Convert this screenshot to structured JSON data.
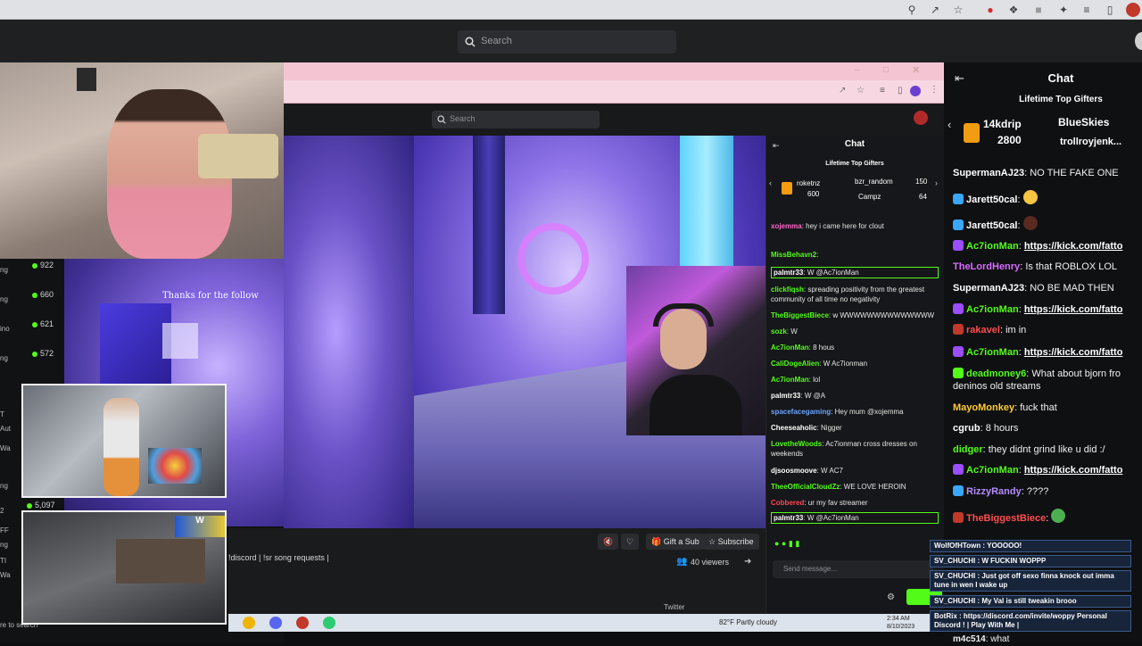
{
  "kick": {
    "search_placeholder": "Search"
  },
  "left_viewers": [
    "922",
    "660",
    "621",
    "572",
    "5,097"
  ],
  "left_side_labels": [
    "ng",
    "ng",
    "ino",
    "ng",
    "T",
    "Aut",
    "Wa",
    "ng",
    "2",
    "FF",
    "ng",
    "TI",
    "Wa",
    "re to search"
  ],
  "overlay_text": "Thanks for the follow",
  "inner": {
    "search_placeholder": "Search",
    "chat_title": "Chat",
    "gifters_title": "Lifetime Top Gifters",
    "top_gifters": [
      {
        "name": "roketnz",
        "amount": "600"
      },
      {
        "name": "bzr_random",
        "amount": "150"
      },
      {
        "name": "Campz",
        "amount": "64"
      }
    ],
    "messages": [
      {
        "user": "xojemma",
        "text": "hey i came here for clout",
        "color": "#ff66cc"
      },
      {
        "user": "MissBehavn2",
        "text": "",
        "color": "#53fc18"
      },
      {
        "user": "palmtr33",
        "text": "W @Ac7ionMan",
        "color": "#ffffff"
      },
      {
        "user": "clickfiqsh",
        "text": "spreading positivity from the greatest community of all time no negativity",
        "color": "#53fc18"
      },
      {
        "user": "TheBiggestBiece",
        "text": "w WWWWWWWWWWWWWW",
        "color": "#53fc18"
      },
      {
        "user": "sozk",
        "text": "W",
        "color": "#53fc18"
      },
      {
        "user": "Ac7ionMan",
        "text": "8 hous",
        "color": "#53fc18"
      },
      {
        "user": "CaliDogeAlien",
        "text": "W Ac7ionman",
        "color": "#53fc18"
      },
      {
        "user": "Ac7ionMan",
        "text": "lol",
        "color": "#53fc18"
      },
      {
        "user": "palmtr33",
        "text": "W @A",
        "color": "#ffffff"
      },
      {
        "user": "spacefacegaming",
        "text": "Hey mum @xojemma",
        "color": "#6aa4ff"
      },
      {
        "user": "Cheeseaholic",
        "text": "Nigger",
        "color": "#ffffff"
      },
      {
        "user": "LovetheWoods",
        "text": "Ac7ionman cross dresses on weekends",
        "color": "#53fc18"
      },
      {
        "user": "djsoosmoove",
        "text": "W AC7",
        "color": "#ffffff"
      },
      {
        "user": "TheeOfficialCloudZz",
        "text": "WE LOVE HEROIN",
        "color": "#53fc18"
      },
      {
        "user": "Cobbered",
        "text": "ur my fav streamer",
        "color": "#ff4455"
      },
      {
        "user": "palmtr33",
        "text": "W @Ac7ionMan",
        "color": "#ffffff"
      }
    ],
    "gift_sub": "Gift a Sub",
    "subscribe": "Subscribe",
    "viewers": "40 viewers",
    "about": "!discord | !sr song requests |",
    "send_placeholder": "Send message...",
    "twitter": "Twitter"
  },
  "taskbar": {
    "weather": "82°F  Partly cloudy",
    "time": "2:34 AM",
    "date": "8/10/2023"
  },
  "outer_chat": {
    "title": "Chat",
    "gifters_title": "Lifetime Top Gifters",
    "top_gifters": [
      {
        "name": "14kdrip",
        "amount": "2800"
      },
      {
        "name": "BlueSkies",
        "amount": ""
      },
      {
        "name": "trollroyjenk...",
        "amount": ""
      }
    ],
    "messages": [
      {
        "user": "SupermanAJ23",
        "text": "NO THE FAKE ONE",
        "color": "#ffffff",
        "badge": ""
      },
      {
        "user": "Jarett50cal",
        "text": "",
        "color": "#ffffff",
        "badge": "#3aa7ff"
      },
      {
        "user": "Jarett50cal",
        "text": "",
        "color": "#ffffff",
        "badge": "#3aa7ff"
      },
      {
        "user": "Ac7ionMan",
        "text": "https://kick.com/fatto",
        "color": "#53fc18",
        "badge": "#9b4dff",
        "link": true
      },
      {
        "user": "TheLordHenry",
        "text": "Is that ROBLOX LOL",
        "color": "#d86bff",
        "badge": ""
      },
      {
        "user": "SupermanAJ23",
        "text": "NO BE MAD THEN",
        "color": "#ffffff",
        "badge": ""
      },
      {
        "user": "Ac7ionMan",
        "text": "https://kick.com/fatto",
        "color": "#53fc18",
        "badge": "#9b4dff",
        "link": true
      },
      {
        "user": "rakavel",
        "text": "im in",
        "color": "#ff4d4d",
        "badge": ""
      },
      {
        "user": "Ac7ionMan",
        "text": "https://kick.com/fatto",
        "color": "#53fc18",
        "badge": "#9b4dff",
        "link": true
      },
      {
        "user": "deadmoney6",
        "text": "What about bjorn fro",
        "color": "#53fc18",
        "badge": "#53fc18"
      },
      {
        "user": "",
        "text": "deninos old streams",
        "color": "#ffffff",
        "badge": ""
      },
      {
        "user": "MayoMonkey",
        "text": "fuck that",
        "color": "#ffcc33",
        "badge": ""
      },
      {
        "user": "cgrub",
        "text": "8 hours",
        "color": "#ffffff",
        "badge": ""
      },
      {
        "user": "didger",
        "text": "they didnt grind like u did :/",
        "color": "#53fc18",
        "badge": ""
      },
      {
        "user": "Ac7ionMan",
        "text": "https://kick.com/fatto",
        "color": "#53fc18",
        "badge": "#9b4dff",
        "link": true
      },
      {
        "user": "RizzyRandy",
        "text": "????",
        "color": "#b68cff",
        "badge": "#3aa7ff"
      },
      {
        "user": "TheBiggestBiece",
        "text": "",
        "color": "#ff4d4d",
        "badge": ""
      }
    ]
  },
  "alerts": [
    {
      "user": "WolfOfHTown",
      "text": "YOOOOO!"
    },
    {
      "user": "SV_CHUCHI",
      "text": "W FUCKIN WOPPP"
    },
    {
      "user": "SV_CHUCHI",
      "text": "Just got off sexo finna knock out imma tune in wen I wake up"
    },
    {
      "user": "SV_CHUCHI",
      "text": "My Val is still tweakin brooo"
    },
    {
      "user": "BotRix",
      "text": "https://discord.com/invite/woppy Personal Discord ! | Play With Me |"
    },
    {
      "user": "m4c514",
      "text": "what"
    }
  ],
  "colors": {
    "kick_green": "#53fc18",
    "bg_dark": "#0f1012"
  }
}
